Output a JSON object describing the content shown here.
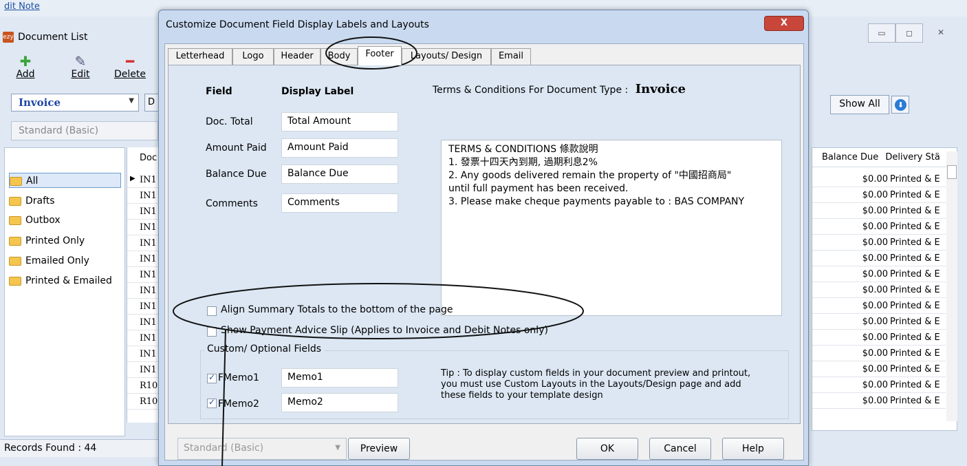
{
  "app": {
    "breadcrumb": "dit Note",
    "window_title": "Document List",
    "logo_text": "ezy",
    "toolbar": {
      "add": "Add",
      "edit": "Edit",
      "delete": "Delete"
    },
    "doc_type": "Invoice",
    "d_button": "D",
    "layout": "Standard (Basic)",
    "folders": [
      "All",
      "Drafts",
      "Outbox",
      "Printed Only",
      "Emailed Only",
      "Printed & Emailed"
    ],
    "selected_folder": "All",
    "doc_column_header": "Doc",
    "doc_rows": [
      "IN1",
      "IN1",
      "IN1",
      "IN1",
      "IN1",
      "IN1",
      "IN1",
      "IN1",
      "IN1",
      "IN1",
      "IN1",
      "IN1",
      "IN1",
      "R10",
      "R10"
    ],
    "records_found": "Records Found : 44",
    "show_all": "Show All",
    "grid_headers": {
      "balance_due": "Balance Due",
      "delivery_status": "Delivery Stä"
    },
    "grid_rows": [
      {
        "balance": "$0.00",
        "delivery": "Printed & E"
      },
      {
        "balance": "$0.00",
        "delivery": "Printed & E"
      },
      {
        "balance": "$0.00",
        "delivery": "Printed & E"
      },
      {
        "balance": "$0.00",
        "delivery": "Printed & E"
      },
      {
        "balance": "$0.00",
        "delivery": "Printed & E"
      },
      {
        "balance": "$0.00",
        "delivery": "Printed & E"
      },
      {
        "balance": "$0.00",
        "delivery": "Printed & E"
      },
      {
        "balance": "$0.00",
        "delivery": "Printed & E"
      },
      {
        "balance": "$0.00",
        "delivery": "Printed & E"
      },
      {
        "balance": "$0.00",
        "delivery": "Printed & E"
      },
      {
        "balance": "$0.00",
        "delivery": "Printed & E"
      },
      {
        "balance": "$0.00",
        "delivery": "Printed & E"
      },
      {
        "balance": "$0.00",
        "delivery": "Printed & E"
      },
      {
        "balance": "$0.00",
        "delivery": "Printed & E"
      },
      {
        "balance": "$0.00",
        "delivery": "Printed & E"
      }
    ]
  },
  "dialog": {
    "title": "Customize Document Field Display Labels and Layouts",
    "close": "X",
    "tabs": [
      "Letterhead",
      "Logo",
      "Header",
      "Body",
      "Footer",
      "Layouts/ Design",
      "Email"
    ],
    "active_tab": "Footer",
    "field_header": "Field",
    "display_label_header": "Display Label",
    "fields": [
      {
        "field": "Doc. Total",
        "label": "Total Amount"
      },
      {
        "field": "Amount Paid",
        "label": "Amount Paid"
      },
      {
        "field": "Balance Due",
        "label": "Balance Due"
      },
      {
        "field": "Comments",
        "label": "Comments"
      }
    ],
    "terms_heading": "Terms & Conditions For Document Type :",
    "terms_doc_type": "Invoice",
    "terms_lines": [
      "TERMS & CONDITIONS 條款說明",
      "1. 發票十四天內到期, 過期利息2%",
      "2. Any goods delivered remain the property of \"中國招商局\"",
      "until full payment has been received.",
      "3. Please make cheque payments payable to : BAS COMPANY"
    ],
    "align_totals": {
      "label": "Align Summary Totals to the bottom of the page",
      "checked": false
    },
    "payment_advice": {
      "label": "Show Payment Advice Slip (Applies to Invoice and Debit Notes only)",
      "checked": false
    },
    "custom_fields_legend": "Custom/ Optional Fields",
    "custom_fields": [
      {
        "name": "FMemo1",
        "value": "Memo1",
        "checked": true
      },
      {
        "name": "FMemo2",
        "value": "Memo2",
        "checked": true
      }
    ],
    "tip": "Tip : To display custom fields in your document preview and printout, you must use Custom Layouts in the Layouts/Design page and add these fields to your template design",
    "layout_select": "Standard (Basic)",
    "buttons": {
      "preview": "Preview",
      "ok": "OK",
      "cancel": "Cancel",
      "help": "Help"
    }
  }
}
